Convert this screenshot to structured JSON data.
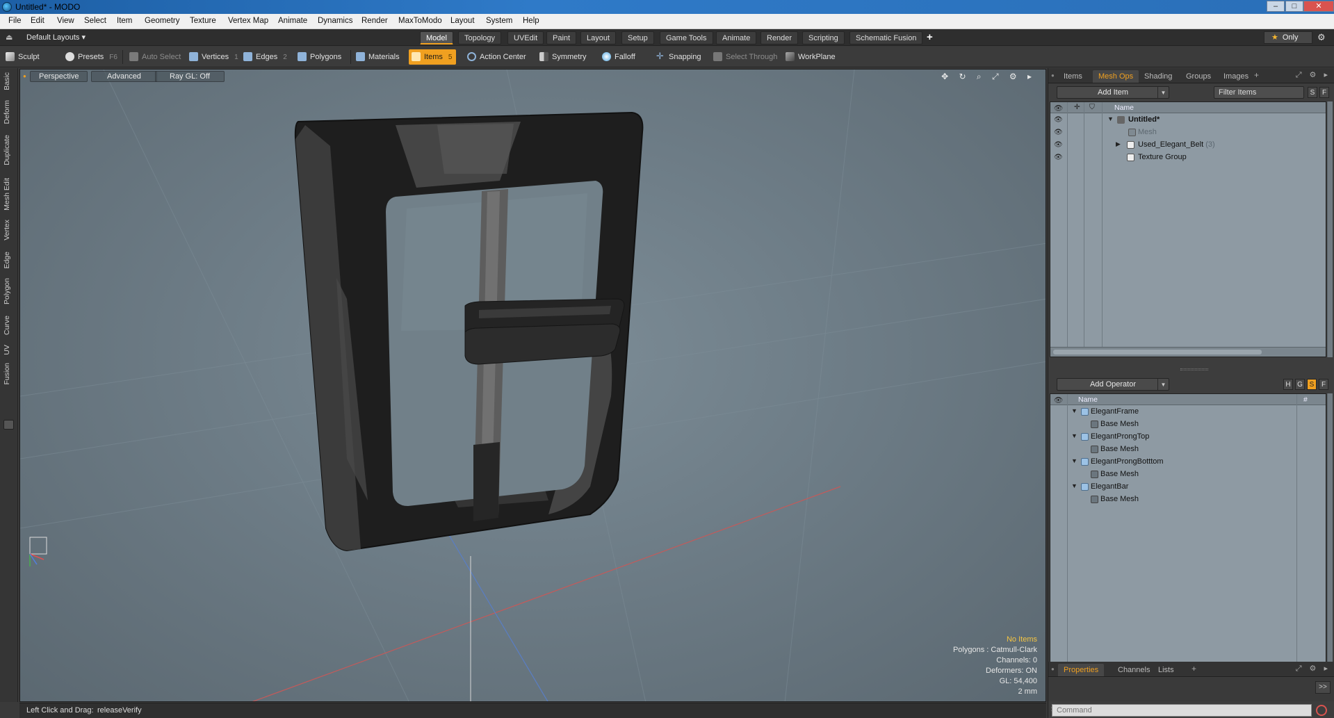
{
  "window": {
    "title": "Untitled* - MODO",
    "minimize": "–",
    "maximize": "□",
    "close": "✕"
  },
  "menu": [
    "File",
    "Edit",
    "View",
    "Select",
    "Item",
    "Geometry",
    "Texture",
    "Vertex Map",
    "Animate",
    "Dynamics",
    "Render",
    "MaxToModo",
    "Layout",
    "System",
    "Help"
  ],
  "layouts": {
    "label": "Default Layouts ▾",
    "tabs": [
      "Model",
      "Topology",
      "UVEdit",
      "Paint",
      "Layout",
      "Setup",
      "Game Tools",
      "Animate",
      "Render",
      "Scripting",
      "Schematic Fusion"
    ],
    "active_tab": "Model",
    "plus": "+",
    "only_label": "Only"
  },
  "toolbar": {
    "sculpt": "Sculpt",
    "presets": "Presets",
    "presets_key": "F6",
    "auto_select": "Auto Select",
    "vertices": "Vertices",
    "vertices_key": "1",
    "edges": "Edges",
    "edges_key": "2",
    "polygons": "Polygons",
    "materials": "Materials",
    "items": "Items",
    "items_key": "5",
    "action_center": "Action Center",
    "symmetry": "Symmetry",
    "falloff": "Falloff",
    "snapping": "Snapping",
    "select_through": "Select Through",
    "workplane": "WorkPlane"
  },
  "left_tabs": [
    "Basic",
    "Deform",
    "Duplicate",
    "Mesh Edit",
    "Vertex",
    "Edge",
    "Polygon",
    "Curve",
    "UV",
    "Fusion"
  ],
  "viewport": {
    "perspective": "Perspective",
    "advanced": "Advanced",
    "raygl": "Ray GL: Off",
    "tool_icons": "✥ ↻ ⌕ ⤢ ⚙ ▸",
    "stats": {
      "no_items": "No Items",
      "polygons": "Polygons : Catmull-Clark",
      "channels": "Channels: 0",
      "deformers": "Deformers: ON",
      "gl": "GL: 54,400",
      "units": "2 mm"
    }
  },
  "statusbar": {
    "hint": "Left Click and Drag:",
    "action": "releaseVerify"
  },
  "items_panel": {
    "tabs": [
      "Items",
      "Mesh Ops",
      "Shading",
      "Groups",
      "Images"
    ],
    "active_tab": "Mesh Ops",
    "plus": "+",
    "icons": "⤢ ⚙ ▸",
    "add_item": "Add Item",
    "filter": "Filter Items",
    "s_btn": "S",
    "f_btn": "F",
    "header_name": "Name",
    "rows": [
      {
        "label": "Untitled*",
        "count": ""
      },
      {
        "label": "Mesh",
        "count": ""
      },
      {
        "label": "Used_Elegant_Belt",
        "count": "(3)"
      },
      {
        "label": "Texture Group",
        "count": ""
      }
    ]
  },
  "meshops_panel": {
    "add_operator": "Add Operator",
    "btn_h": "H",
    "btn_g": "G",
    "btn_s": "S",
    "btn_f": "F",
    "header_name": "Name",
    "header_hash": "#",
    "rows": [
      {
        "label": "ElegantFrame"
      },
      {
        "label": "Base Mesh"
      },
      {
        "label": "ElegantProngTop"
      },
      {
        "label": "Base Mesh"
      },
      {
        "label": "ElegantProngBotttom"
      },
      {
        "label": "Base Mesh"
      },
      {
        "label": "ElegantBar"
      },
      {
        "label": "Base Mesh"
      }
    ]
  },
  "properties_panel": {
    "tabs": [
      "Properties",
      "Channels",
      "Lists"
    ],
    "active_tab": "Properties",
    "plus": "+",
    "expand": ">>"
  },
  "command": {
    "placeholder": "Command"
  },
  "colors": {
    "accent": "#f0a020",
    "viewport_bg": "#6d7c86",
    "tree_bg": "#8e9aa3"
  }
}
